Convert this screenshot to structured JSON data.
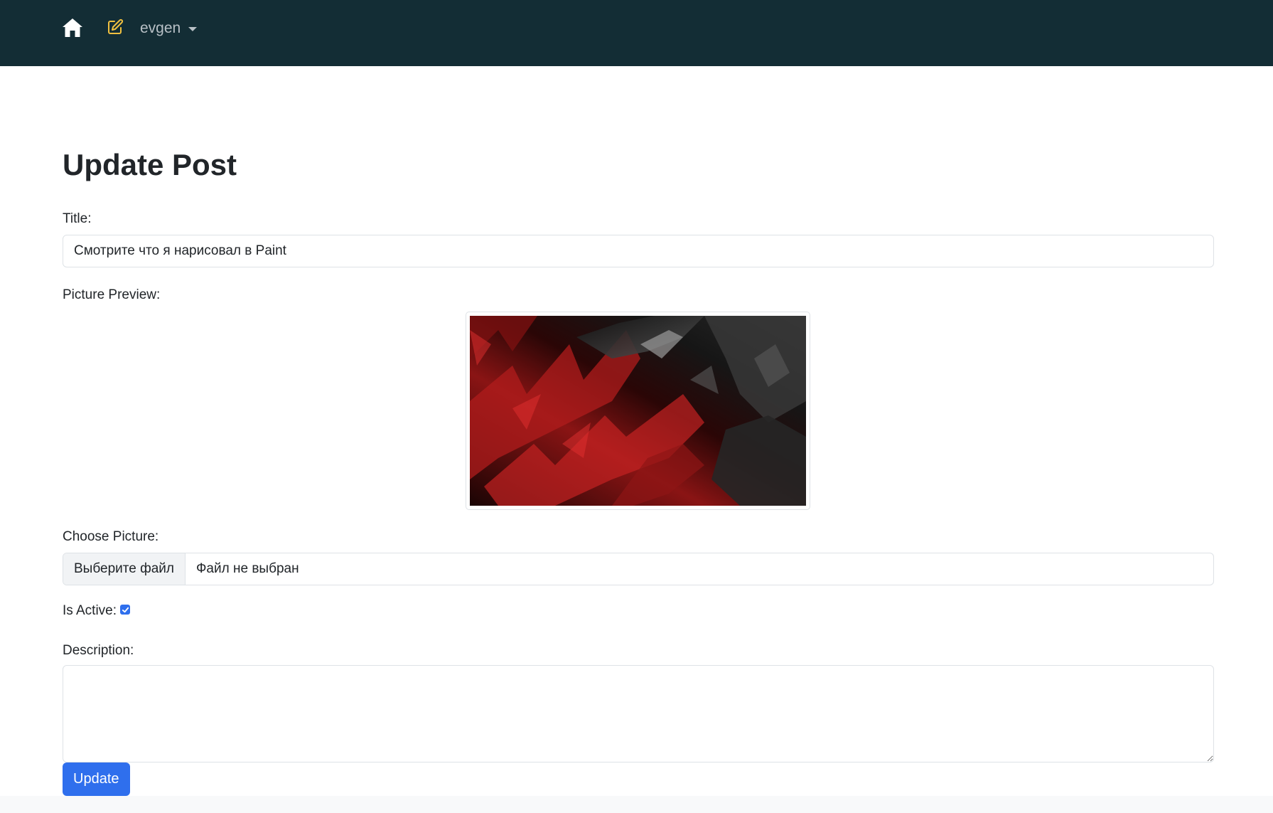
{
  "navbar": {
    "home_icon": "home-icon",
    "edit_icon": "edit-icon",
    "user_name": "evgen",
    "background": "#132d35",
    "edit_icon_color": "#f0c040"
  },
  "page": {
    "title": "Update Post"
  },
  "form": {
    "title_label": "Title:",
    "title_value": "Смотрите что я нарисовал в Paint",
    "preview_label": "Picture Preview:",
    "choose_label": "Choose Picture:",
    "file_button_label": "Выберите файл",
    "file_status": "Файл не выбран",
    "active_label": "Is Active:",
    "active_checked": true,
    "description_label": "Description:",
    "description_value": "",
    "submit_label": "Update",
    "accent": "#2f6fed"
  }
}
